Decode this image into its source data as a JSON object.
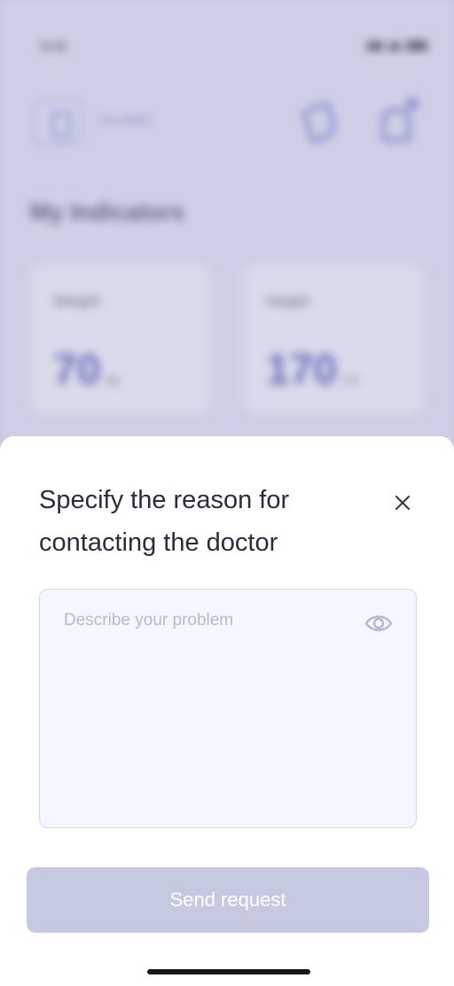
{
  "status_bar": {
    "time": "9:41"
  },
  "background": {
    "clinic_name": "CLINIC",
    "section_title": "My Indicators",
    "indicators": [
      {
        "label": "Weight",
        "value": "70",
        "unit": "kg"
      },
      {
        "label": "Height",
        "value": "170",
        "unit": "cm"
      }
    ]
  },
  "modal": {
    "title": "Specify the reason for contacting the doctor",
    "problem_placeholder": "Describe your problem",
    "problem_value": "",
    "send_label": "Send request"
  },
  "colors": {
    "accent": "#3a42a6",
    "button_disabled": "#c5cae0",
    "input_bg": "#f5f7fe",
    "title_text": "#2b2d3d",
    "placeholder": "#b4b9cc"
  }
}
